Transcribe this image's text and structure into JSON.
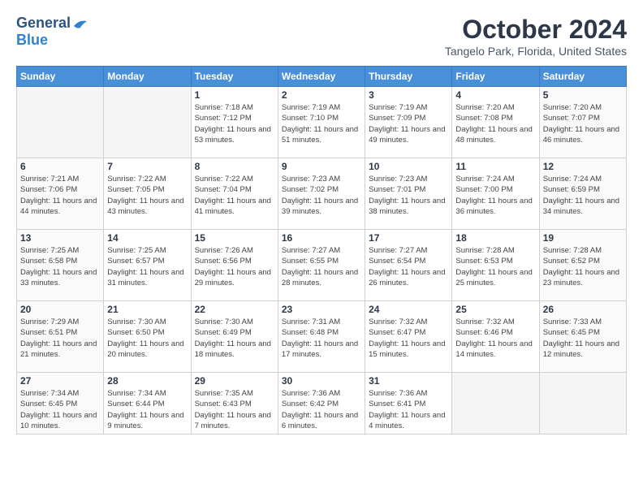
{
  "header": {
    "logo_general": "General",
    "logo_blue": "Blue",
    "title": "October 2024",
    "subtitle": "Tangelo Park, Florida, United States"
  },
  "days_of_week": [
    "Sunday",
    "Monday",
    "Tuesday",
    "Wednesday",
    "Thursday",
    "Friday",
    "Saturday"
  ],
  "weeks": [
    [
      {
        "day": "",
        "info": ""
      },
      {
        "day": "",
        "info": ""
      },
      {
        "day": "1",
        "info": "Sunrise: 7:18 AM\nSunset: 7:12 PM\nDaylight: 11 hours and 53 minutes."
      },
      {
        "day": "2",
        "info": "Sunrise: 7:19 AM\nSunset: 7:10 PM\nDaylight: 11 hours and 51 minutes."
      },
      {
        "day": "3",
        "info": "Sunrise: 7:19 AM\nSunset: 7:09 PM\nDaylight: 11 hours and 49 minutes."
      },
      {
        "day": "4",
        "info": "Sunrise: 7:20 AM\nSunset: 7:08 PM\nDaylight: 11 hours and 48 minutes."
      },
      {
        "day": "5",
        "info": "Sunrise: 7:20 AM\nSunset: 7:07 PM\nDaylight: 11 hours and 46 minutes."
      }
    ],
    [
      {
        "day": "6",
        "info": "Sunrise: 7:21 AM\nSunset: 7:06 PM\nDaylight: 11 hours and 44 minutes."
      },
      {
        "day": "7",
        "info": "Sunrise: 7:22 AM\nSunset: 7:05 PM\nDaylight: 11 hours and 43 minutes."
      },
      {
        "day": "8",
        "info": "Sunrise: 7:22 AM\nSunset: 7:04 PM\nDaylight: 11 hours and 41 minutes."
      },
      {
        "day": "9",
        "info": "Sunrise: 7:23 AM\nSunset: 7:02 PM\nDaylight: 11 hours and 39 minutes."
      },
      {
        "day": "10",
        "info": "Sunrise: 7:23 AM\nSunset: 7:01 PM\nDaylight: 11 hours and 38 minutes."
      },
      {
        "day": "11",
        "info": "Sunrise: 7:24 AM\nSunset: 7:00 PM\nDaylight: 11 hours and 36 minutes."
      },
      {
        "day": "12",
        "info": "Sunrise: 7:24 AM\nSunset: 6:59 PM\nDaylight: 11 hours and 34 minutes."
      }
    ],
    [
      {
        "day": "13",
        "info": "Sunrise: 7:25 AM\nSunset: 6:58 PM\nDaylight: 11 hours and 33 minutes."
      },
      {
        "day": "14",
        "info": "Sunrise: 7:25 AM\nSunset: 6:57 PM\nDaylight: 11 hours and 31 minutes."
      },
      {
        "day": "15",
        "info": "Sunrise: 7:26 AM\nSunset: 6:56 PM\nDaylight: 11 hours and 29 minutes."
      },
      {
        "day": "16",
        "info": "Sunrise: 7:27 AM\nSunset: 6:55 PM\nDaylight: 11 hours and 28 minutes."
      },
      {
        "day": "17",
        "info": "Sunrise: 7:27 AM\nSunset: 6:54 PM\nDaylight: 11 hours and 26 minutes."
      },
      {
        "day": "18",
        "info": "Sunrise: 7:28 AM\nSunset: 6:53 PM\nDaylight: 11 hours and 25 minutes."
      },
      {
        "day": "19",
        "info": "Sunrise: 7:28 AM\nSunset: 6:52 PM\nDaylight: 11 hours and 23 minutes."
      }
    ],
    [
      {
        "day": "20",
        "info": "Sunrise: 7:29 AM\nSunset: 6:51 PM\nDaylight: 11 hours and 21 minutes."
      },
      {
        "day": "21",
        "info": "Sunrise: 7:30 AM\nSunset: 6:50 PM\nDaylight: 11 hours and 20 minutes."
      },
      {
        "day": "22",
        "info": "Sunrise: 7:30 AM\nSunset: 6:49 PM\nDaylight: 11 hours and 18 minutes."
      },
      {
        "day": "23",
        "info": "Sunrise: 7:31 AM\nSunset: 6:48 PM\nDaylight: 11 hours and 17 minutes."
      },
      {
        "day": "24",
        "info": "Sunrise: 7:32 AM\nSunset: 6:47 PM\nDaylight: 11 hours and 15 minutes."
      },
      {
        "day": "25",
        "info": "Sunrise: 7:32 AM\nSunset: 6:46 PM\nDaylight: 11 hours and 14 minutes."
      },
      {
        "day": "26",
        "info": "Sunrise: 7:33 AM\nSunset: 6:45 PM\nDaylight: 11 hours and 12 minutes."
      }
    ],
    [
      {
        "day": "27",
        "info": "Sunrise: 7:34 AM\nSunset: 6:45 PM\nDaylight: 11 hours and 10 minutes."
      },
      {
        "day": "28",
        "info": "Sunrise: 7:34 AM\nSunset: 6:44 PM\nDaylight: 11 hours and 9 minutes."
      },
      {
        "day": "29",
        "info": "Sunrise: 7:35 AM\nSunset: 6:43 PM\nDaylight: 11 hours and 7 minutes."
      },
      {
        "day": "30",
        "info": "Sunrise: 7:36 AM\nSunset: 6:42 PM\nDaylight: 11 hours and 6 minutes."
      },
      {
        "day": "31",
        "info": "Sunrise: 7:36 AM\nSunset: 6:41 PM\nDaylight: 11 hours and 4 minutes."
      },
      {
        "day": "",
        "info": ""
      },
      {
        "day": "",
        "info": ""
      }
    ]
  ]
}
